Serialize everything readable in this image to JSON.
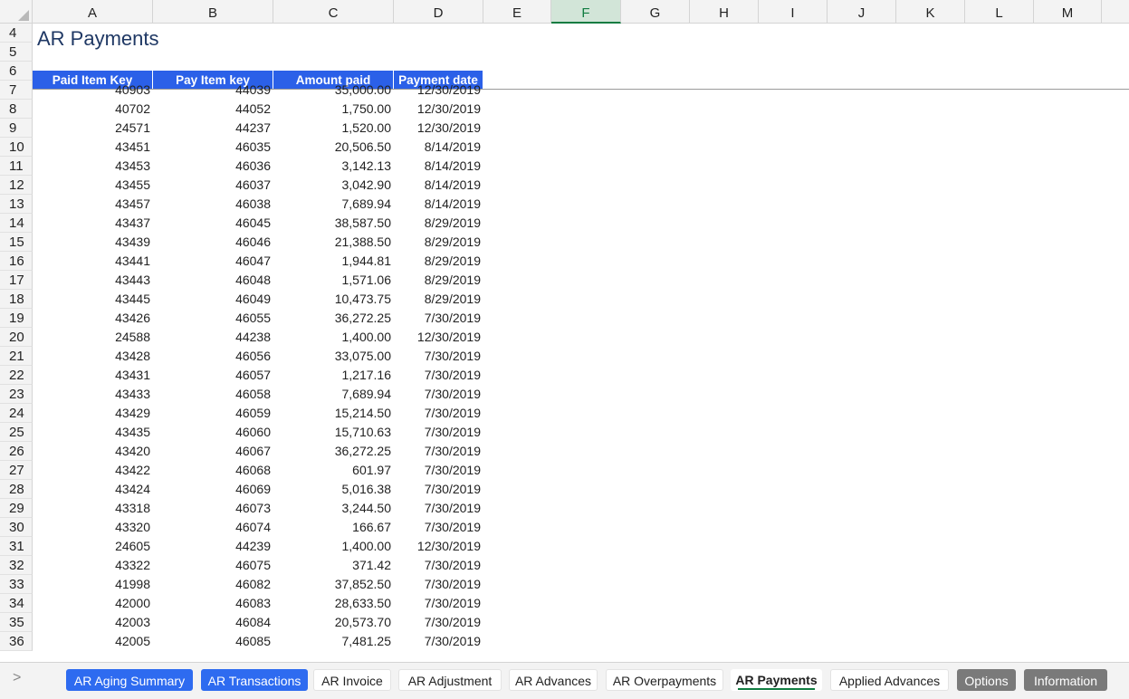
{
  "sheet": {
    "title": "AR Payments",
    "columns": [
      "A",
      "B",
      "C",
      "D",
      "E",
      "F",
      "G",
      "H",
      "I",
      "J",
      "K",
      "L",
      "M"
    ],
    "selected_column": "F",
    "row_numbers": [
      "4",
      "5",
      "6",
      "7",
      "8",
      "9",
      "10",
      "11",
      "12",
      "13",
      "14",
      "15",
      "16",
      "17",
      "18",
      "19",
      "20",
      "21",
      "22",
      "23",
      "24",
      "25",
      "26",
      "27",
      "28",
      "29",
      "30",
      "31",
      "32",
      "33",
      "34",
      "35",
      "36"
    ],
    "headers": [
      "Paid Item Key",
      "Pay Item key",
      "Amount paid",
      "Payment date"
    ],
    "rows": [
      [
        "40903",
        "44039",
        "35,000.00",
        "12/30/2019"
      ],
      [
        "40702",
        "44052",
        "1,750.00",
        "12/30/2019"
      ],
      [
        "24571",
        "44237",
        "1,520.00",
        "12/30/2019"
      ],
      [
        "43451",
        "46035",
        "20,506.50",
        "8/14/2019"
      ],
      [
        "43453",
        "46036",
        "3,142.13",
        "8/14/2019"
      ],
      [
        "43455",
        "46037",
        "3,042.90",
        "8/14/2019"
      ],
      [
        "43457",
        "46038",
        "7,689.94",
        "8/14/2019"
      ],
      [
        "43437",
        "46045",
        "38,587.50",
        "8/29/2019"
      ],
      [
        "43439",
        "46046",
        "21,388.50",
        "8/29/2019"
      ],
      [
        "43441",
        "46047",
        "1,944.81",
        "8/29/2019"
      ],
      [
        "43443",
        "46048",
        "1,571.06",
        "8/29/2019"
      ],
      [
        "43445",
        "46049",
        "10,473.75",
        "8/29/2019"
      ],
      [
        "43426",
        "46055",
        "36,272.25",
        "7/30/2019"
      ],
      [
        "24588",
        "44238",
        "1,400.00",
        "12/30/2019"
      ],
      [
        "43428",
        "46056",
        "33,075.00",
        "7/30/2019"
      ],
      [
        "43431",
        "46057",
        "1,217.16",
        "7/30/2019"
      ],
      [
        "43433",
        "46058",
        "7,689.94",
        "7/30/2019"
      ],
      [
        "43429",
        "46059",
        "15,214.50",
        "7/30/2019"
      ],
      [
        "43435",
        "46060",
        "15,710.63",
        "7/30/2019"
      ],
      [
        "43420",
        "46067",
        "36,272.25",
        "7/30/2019"
      ],
      [
        "43422",
        "46068",
        "601.97",
        "7/30/2019"
      ],
      [
        "43424",
        "46069",
        "5,016.38",
        "7/30/2019"
      ],
      [
        "43318",
        "46073",
        "3,244.50",
        "7/30/2019"
      ],
      [
        "43320",
        "46074",
        "166.67",
        "7/30/2019"
      ],
      [
        "24605",
        "44239",
        "1,400.00",
        "12/30/2019"
      ],
      [
        "43322",
        "46075",
        "371.42",
        "7/30/2019"
      ],
      [
        "41998",
        "46082",
        "37,852.50",
        "7/30/2019"
      ],
      [
        "42000",
        "46083",
        "28,633.50",
        "7/30/2019"
      ],
      [
        "42003",
        "46084",
        "20,573.70",
        "7/30/2019"
      ],
      [
        "42005",
        "46085",
        "7,481.25",
        "7/30/2019"
      ]
    ]
  },
  "tabs": [
    {
      "label": "AR Aging Summary",
      "style": "blue"
    },
    {
      "label": "AR Transactions",
      "style": "blue"
    },
    {
      "label": "AR Invoice",
      "style": "plain"
    },
    {
      "label": "AR Adjustment",
      "style": "plain"
    },
    {
      "label": "AR Advances",
      "style": "plain"
    },
    {
      "label": "AR Overpayments",
      "style": "plain"
    },
    {
      "label": "AR Payments",
      "style": "active"
    },
    {
      "label": "Applied Advances",
      "style": "plain"
    },
    {
      "label": "Options",
      "style": "gray"
    },
    {
      "label": "Information",
      "style": "gray"
    }
  ],
  "nav": {
    "scroll_arrow": ">"
  },
  "colors": {
    "header_blue": "#2b60e8",
    "tab_blue": "#2e6bf0",
    "active_green": "#107c41",
    "title_navy": "#1f3864"
  }
}
